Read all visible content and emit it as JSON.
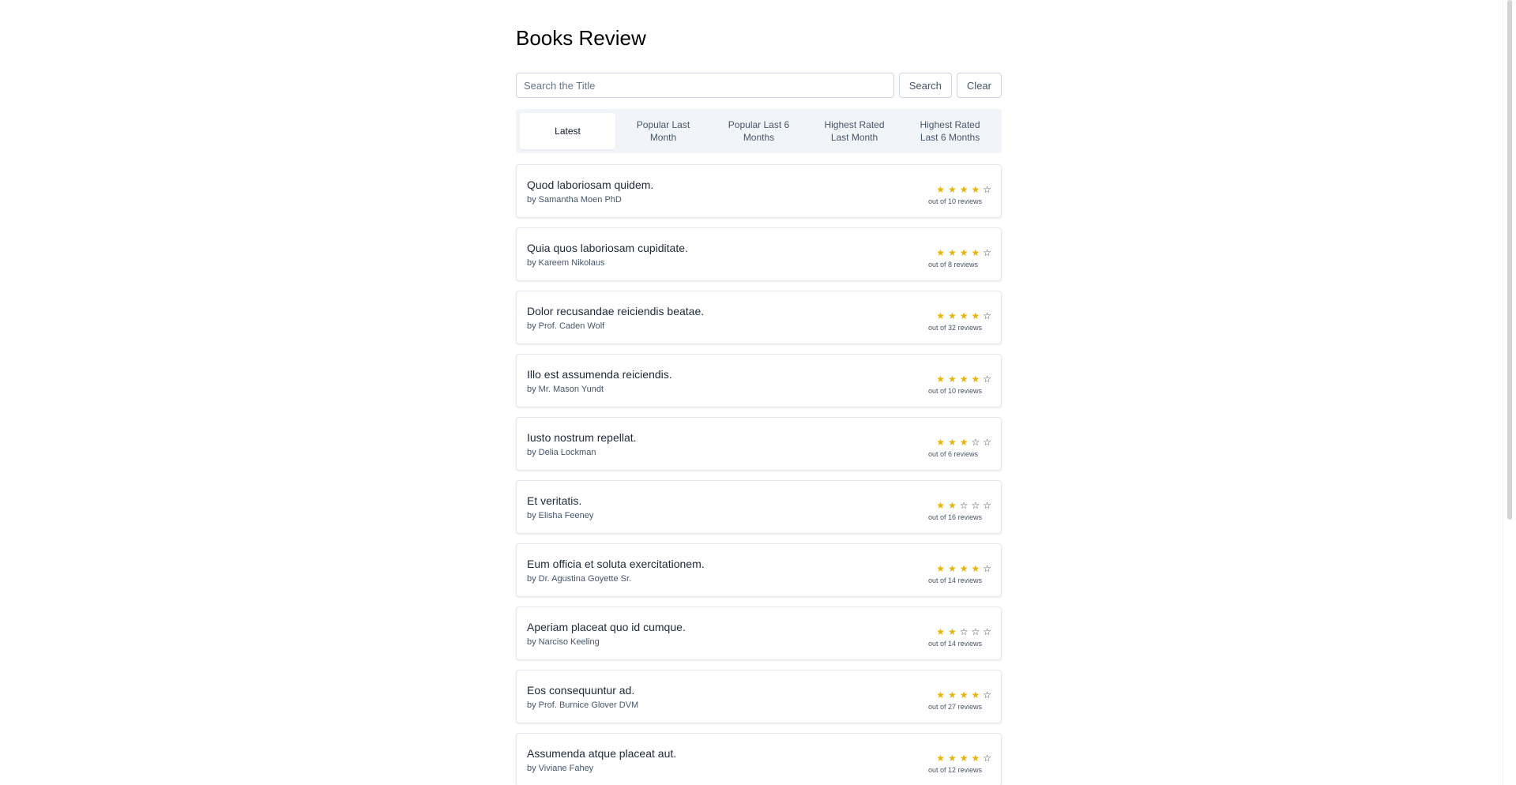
{
  "page": {
    "title": "Books Review"
  },
  "search": {
    "placeholder": "Search the Title",
    "value": "",
    "search_label": "Search",
    "clear_label": "Clear"
  },
  "tabs": [
    {
      "label": "Latest",
      "active": true
    },
    {
      "label": "Popular Last Month",
      "active": false
    },
    {
      "label": "Popular Last 6 Months",
      "active": false
    },
    {
      "label": "Highest Rated Last Month",
      "active": false
    },
    {
      "label": "Highest Rated Last 6 Months",
      "active": false
    }
  ],
  "colors": {
    "star_filled": "#eab308",
    "star_empty": "#334155"
  },
  "books": [
    {
      "title": "Quod laboriosam quidem.",
      "author": "by Samantha Moen PhD",
      "rating": 4,
      "reviews": "out of 10 reviews"
    },
    {
      "title": "Quia quos laboriosam cupiditate.",
      "author": "by Kareem Nikolaus",
      "rating": 4,
      "reviews": "out of 8 reviews"
    },
    {
      "title": "Dolor recusandae reiciendis beatae.",
      "author": "by Prof. Caden Wolf",
      "rating": 4,
      "reviews": "out of 32 reviews"
    },
    {
      "title": "Illo est assumenda reiciendis.",
      "author": "by Mr. Mason Yundt",
      "rating": 4,
      "reviews": "out of 10 reviews"
    },
    {
      "title": "Iusto nostrum repellat.",
      "author": "by Delia Lockman",
      "rating": 3,
      "reviews": "out of 6 reviews"
    },
    {
      "title": "Et veritatis.",
      "author": "by Elisha Feeney",
      "rating": 2,
      "reviews": "out of 16 reviews"
    },
    {
      "title": "Eum officia et soluta exercitationem.",
      "author": "by Dr. Agustina Goyette Sr.",
      "rating": 4,
      "reviews": "out of 14 reviews"
    },
    {
      "title": "Aperiam placeat quo id cumque.",
      "author": "by Narciso Keeling",
      "rating": 2,
      "reviews": "out of 14 reviews"
    },
    {
      "title": "Eos consequuntur ad.",
      "author": "by Prof. Burnice Glover DVM",
      "rating": 4,
      "reviews": "out of 27 reviews"
    },
    {
      "title": "Assumenda atque placeat aut.",
      "author": "by Viviane Fahey",
      "rating": 4,
      "reviews": "out of 12 reviews"
    }
  ]
}
